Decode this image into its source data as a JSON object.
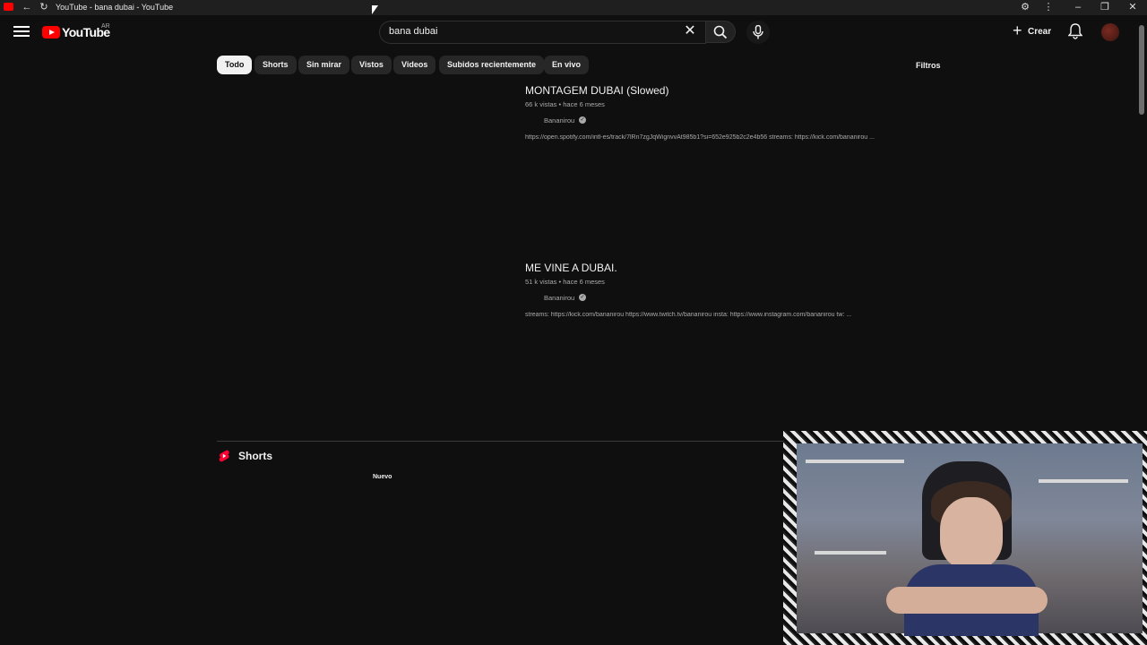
{
  "browser": {
    "tab_title": "YouTube - bana dubai - YouTube"
  },
  "masthead": {
    "logo_text": "YouTube",
    "country_code": "AR",
    "search_value": "bana dubai",
    "create_label": "Crear"
  },
  "chips": [
    "Todo",
    "Shorts",
    "Sin mirar",
    "Vistos",
    "Videos",
    "Subidos recientemente",
    "En vivo"
  ],
  "filters_label": "Filtros",
  "results": [
    {
      "title": "MONTAGEM DUBAI (Slowed)",
      "meta": "66 k vistas • hace 6 meses",
      "channel": "Bananirou",
      "description": "https://open.spotify.com/intl-es/track/7lRn7zgJqWignvvAt985b1?si=652e925b2c2e4b56 streams: https://kick.com/bananirou ..."
    },
    {
      "title": "ME VINE A DUBAI.",
      "meta": "51 k vistas • hace 6 meses",
      "channel": "Bananirou",
      "description": "streams: https://kick.com/bananirou https://www.twitch.tv/bananirou insta: https://www.instagram.com/bananirou tw: ..."
    }
  ],
  "shorts_section": {
    "title": "Shorts",
    "badge": "Nuevo"
  },
  "colors": {
    "background": "#0f0f0f",
    "brand_red": "#ff0000",
    "chip_bg": "#272727",
    "text_secondary": "#aaaaaa"
  }
}
